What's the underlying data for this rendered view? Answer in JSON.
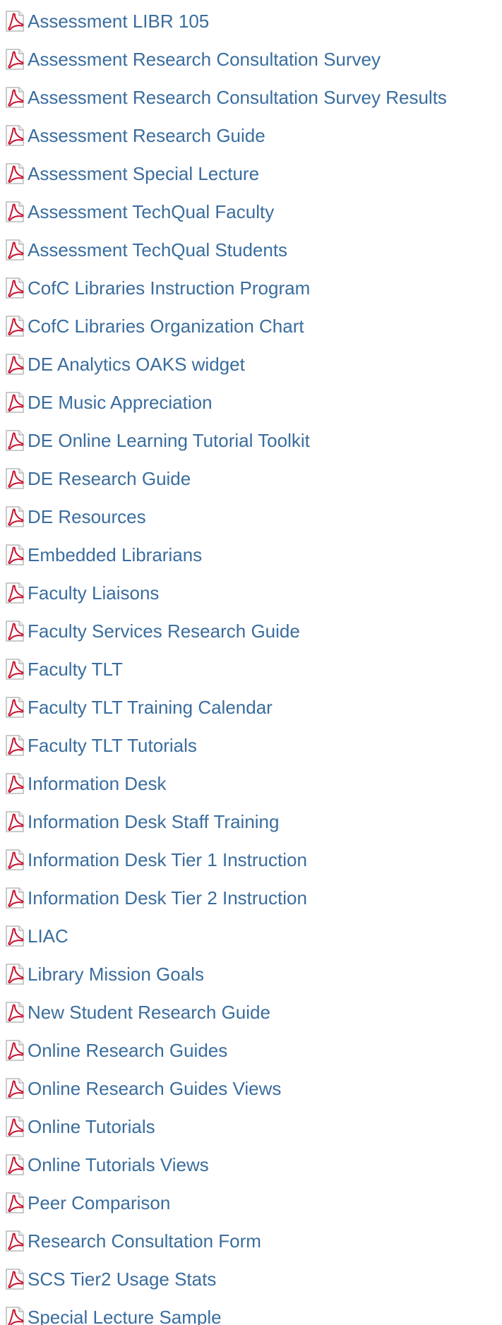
{
  "files": [
    {
      "label": "Assessment LIBR 105",
      "icon": "pdf-icon"
    },
    {
      "label": "Assessment Research Consultation Survey",
      "icon": "pdf-icon"
    },
    {
      "label": "Assessment Research Consultation Survey Results",
      "icon": "pdf-icon"
    },
    {
      "label": "Assessment Research Guide",
      "icon": "pdf-icon"
    },
    {
      "label": "Assessment Special Lecture",
      "icon": "pdf-icon"
    },
    {
      "label": "Assessment TechQual Faculty",
      "icon": "pdf-icon"
    },
    {
      "label": "Assessment TechQual Students",
      "icon": "pdf-icon"
    },
    {
      "label": "CofC Libraries Instruction Program",
      "icon": "pdf-icon"
    },
    {
      "label": "CofC Libraries Organization Chart",
      "icon": "pdf-icon"
    },
    {
      "label": "DE Analytics OAKS widget",
      "icon": "pdf-icon"
    },
    {
      "label": "DE Music Appreciation",
      "icon": "pdf-icon"
    },
    {
      "label": "DE Online Learning Tutorial Toolkit",
      "icon": "pdf-icon"
    },
    {
      "label": "DE Research Guide",
      "icon": "pdf-icon"
    },
    {
      "label": "DE Resources",
      "icon": "pdf-icon"
    },
    {
      "label": "Embedded Librarians",
      "icon": "pdf-icon"
    },
    {
      "label": "Faculty Liaisons",
      "icon": "pdf-icon"
    },
    {
      "label": "Faculty Services Research Guide",
      "icon": "pdf-icon"
    },
    {
      "label": "Faculty TLT",
      "icon": "pdf-icon"
    },
    {
      "label": "Faculty TLT Training Calendar",
      "icon": "pdf-icon"
    },
    {
      "label": "Faculty TLT Tutorials",
      "icon": "pdf-icon"
    },
    {
      "label": "Information Desk",
      "icon": "pdf-icon"
    },
    {
      "label": "Information Desk Staff Training",
      "icon": "pdf-icon"
    },
    {
      "label": "Information Desk Tier 1 Instruction",
      "icon": "pdf-icon"
    },
    {
      "label": "Information Desk Tier 2 Instruction",
      "icon": "pdf-icon"
    },
    {
      "label": "LIAC",
      "icon": "pdf-icon"
    },
    {
      "label": "Library Mission Goals",
      "icon": "pdf-icon"
    },
    {
      "label": "New Student Research Guide",
      "icon": "pdf-icon"
    },
    {
      "label": "Online Research Guides",
      "icon": "pdf-icon"
    },
    {
      "label": "Online Research Guides Views",
      "icon": "pdf-icon"
    },
    {
      "label": "Online Tutorials",
      "icon": "pdf-icon"
    },
    {
      "label": "Online Tutorials Views",
      "icon": "pdf-icon"
    },
    {
      "label": "Peer Comparison",
      "icon": "pdf-icon"
    },
    {
      "label": "Research Consultation Form",
      "icon": "pdf-icon"
    },
    {
      "label": "SCS Tier2 Usage Stats",
      "icon": "pdf-icon"
    },
    {
      "label": "Special Lecture Sample",
      "icon": "pdf-icon"
    }
  ],
  "colors": {
    "link": "#3a6d9e",
    "pdf_red": "#c8102e"
  }
}
